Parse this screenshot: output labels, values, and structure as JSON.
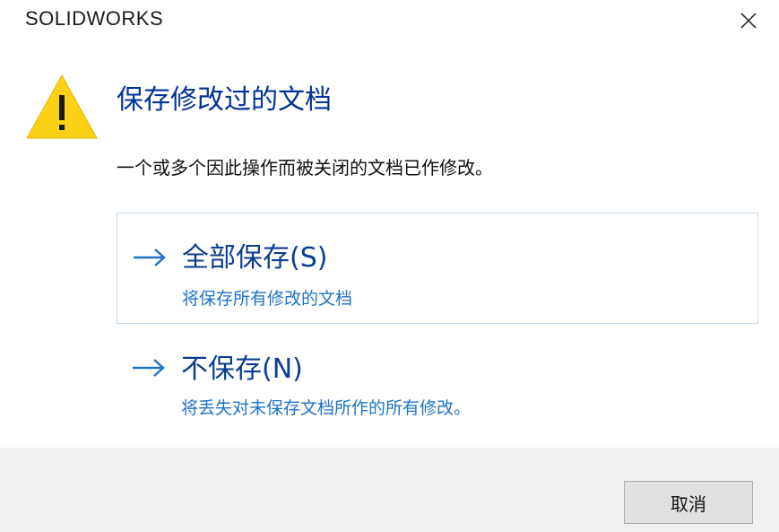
{
  "window": {
    "title": "SOLIDWORKS"
  },
  "icons": {
    "warning": "warning-icon",
    "close": "close-icon",
    "arrow": "arrow-right-icon"
  },
  "dialog": {
    "main_instruction": "保存修改过的文档",
    "content": "一个或多个因此操作而被关闭的文档已作修改。",
    "commands": [
      {
        "label": "全部保存(S)",
        "note": "将保存所有修改的文档"
      },
      {
        "label": "不保存(N)",
        "note": "将丢失对未保存文档所作的所有修改。"
      }
    ],
    "cancel_label": "取消"
  },
  "colors": {
    "instruction": "#003399",
    "command_label": "#0a3d91",
    "command_note": "#1e73c8",
    "warning_fill": "#fcd116",
    "footer_bg": "#f0f0f0"
  }
}
